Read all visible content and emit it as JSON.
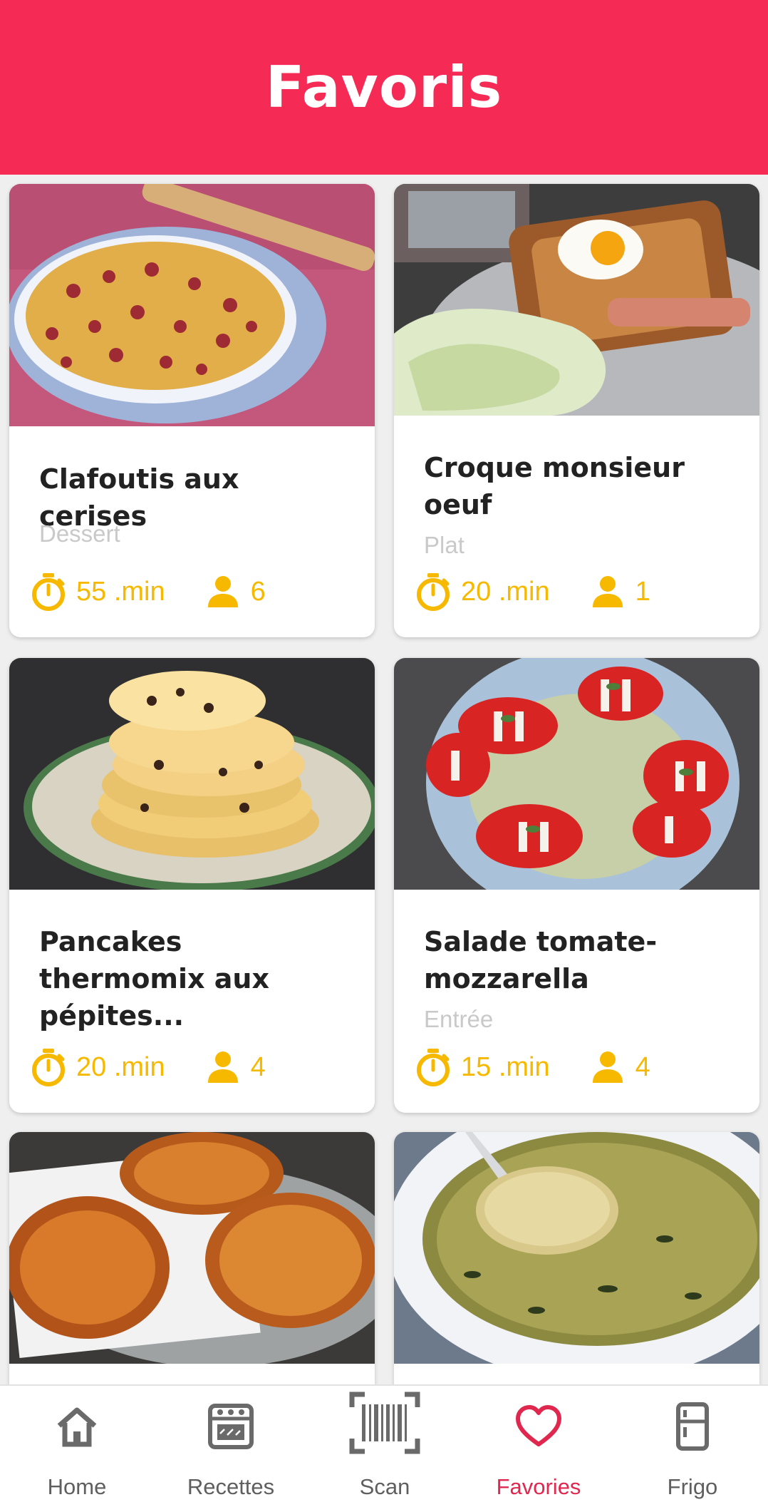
{
  "header": {
    "title": "Favoris",
    "color": "#f52b56"
  },
  "recipes": [
    {
      "title": "Clafoutis aux cerises",
      "category": "Dessert",
      "time": "55 .min",
      "servings": "6"
    },
    {
      "title": "Croque monsieur oeuf",
      "category": "Plat",
      "time": "20 .min",
      "servings": "1"
    },
    {
      "title": "Pancakes thermomix aux pépites...",
      "category": "",
      "time": "20 .min",
      "servings": "4"
    },
    {
      "title": "Salade tomate-mozzarella",
      "category": "Entrée",
      "time": "15 .min",
      "servings": "4"
    },
    {
      "title": "",
      "category": "",
      "time": "",
      "servings": ""
    },
    {
      "title": "",
      "category": "",
      "time": "",
      "servings": ""
    }
  ],
  "icons": {
    "time": "stopwatch-icon",
    "servings": "person-icon"
  },
  "accent_color": "#f7b900",
  "nav": [
    {
      "label": "Home",
      "icon": "home-icon"
    },
    {
      "label": "Recettes",
      "icon": "oven-icon"
    },
    {
      "label": "Scan",
      "icon": "barcode-scan-icon"
    },
    {
      "label": "Favories",
      "icon": "heart-icon",
      "active": true
    },
    {
      "label": "Frigo",
      "icon": "fridge-icon"
    }
  ]
}
